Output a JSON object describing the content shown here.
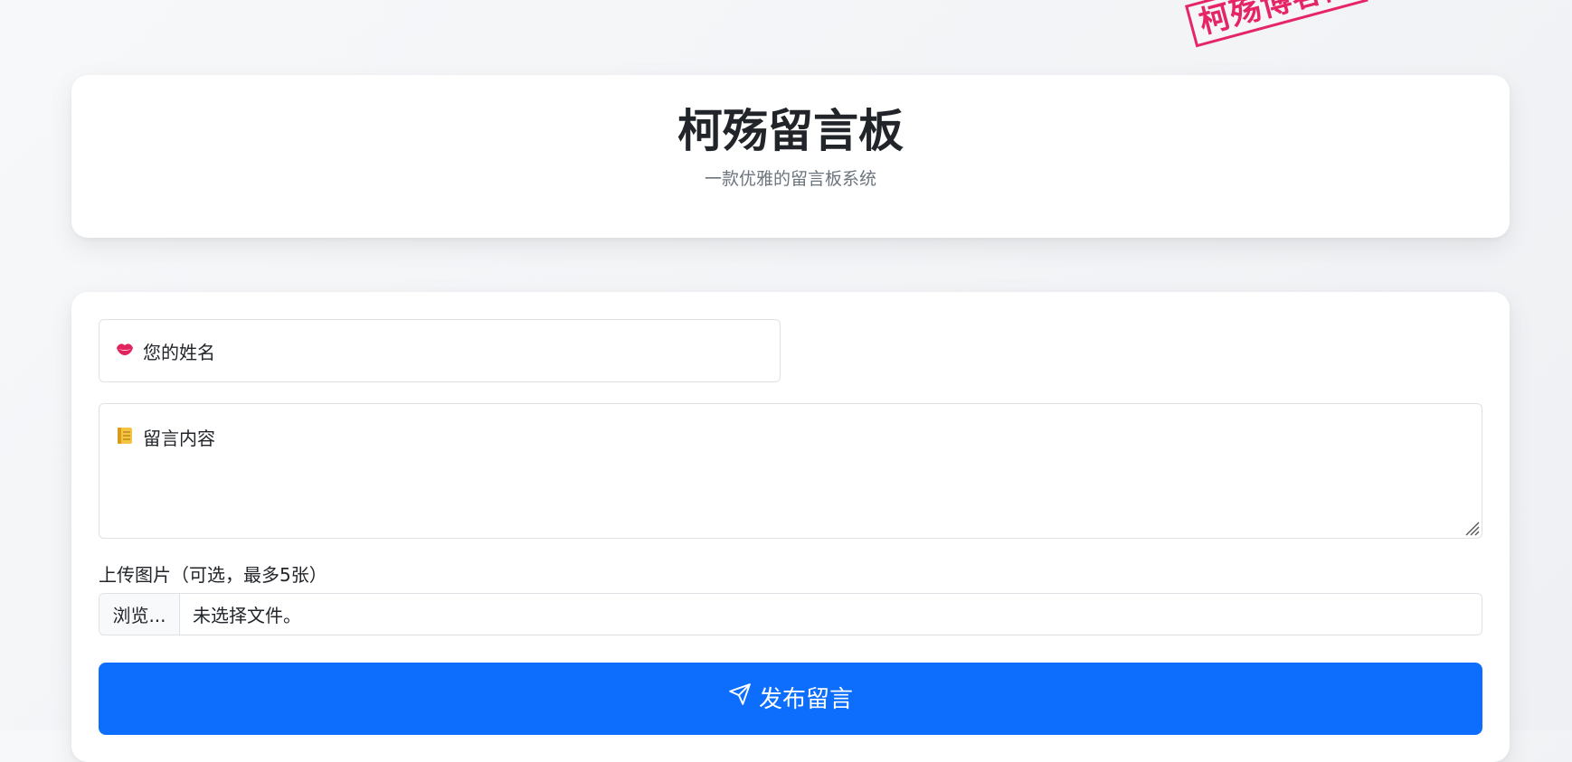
{
  "stamp": {
    "text": "柯殇博客网",
    "color": "#e4145a"
  },
  "header": {
    "title": "柯殇留言板",
    "subtitle": "一款优雅的留言板系统"
  },
  "form": {
    "name_placeholder": "您的姓名",
    "name_icon": "lips-icon",
    "message_placeholder": "留言内容",
    "message_icon": "notebook-icon",
    "upload_label": "上传图片（可选，最多5张）",
    "browse_label": "浏览...",
    "file_status": "未选择文件。",
    "submit_label": "发布留言",
    "submit_icon": "send-icon",
    "accent_color": "#0d6efd"
  }
}
